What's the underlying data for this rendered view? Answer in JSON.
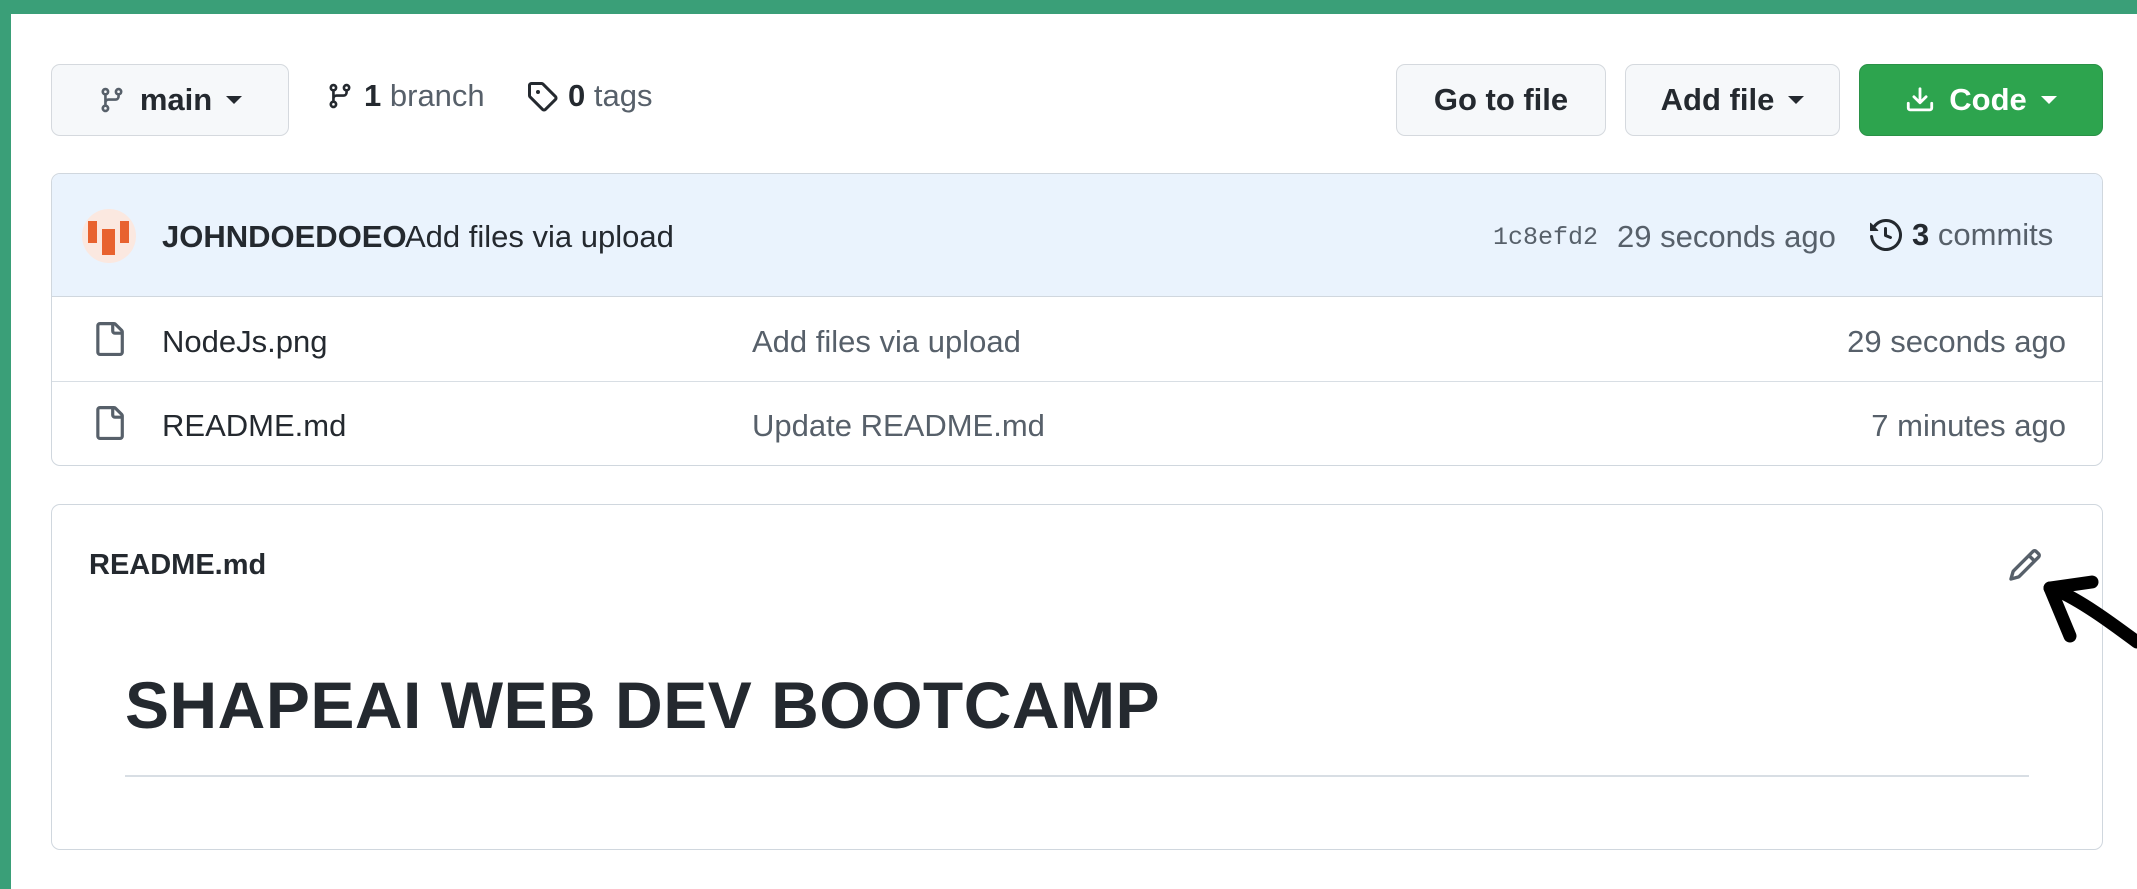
{
  "toolbar": {
    "branch_name": "main",
    "branch_count": "1",
    "branch_label": "branch",
    "tag_count": "0",
    "tag_label": "tags",
    "go_to_file": "Go to file",
    "add_file": "Add file",
    "code": "Code"
  },
  "latest_commit": {
    "author": "JOHNDOEDOEO",
    "message": "Add files via upload",
    "sha": "1c8efd2",
    "time": "29 seconds ago",
    "commit_count": "3",
    "commit_label": "commits"
  },
  "files": [
    {
      "name": "NodeJs.png",
      "message": "Add files via upload",
      "age": "29 seconds ago"
    },
    {
      "name": "README.md",
      "message": "Update README.md",
      "age": "7 minutes ago"
    }
  ],
  "readme": {
    "filename": "README.md",
    "heading": "SHAPEAI WEB DEV BOOTCAMP"
  },
  "colors": {
    "frame": "#3a9f78",
    "code_button": "#2da44e",
    "commit_bar": "#eaf3fd"
  },
  "icons": [
    "git-branch-icon",
    "tag-icon",
    "download-icon",
    "history-icon",
    "file-icon",
    "pencil-icon",
    "arrow-annotation"
  ]
}
